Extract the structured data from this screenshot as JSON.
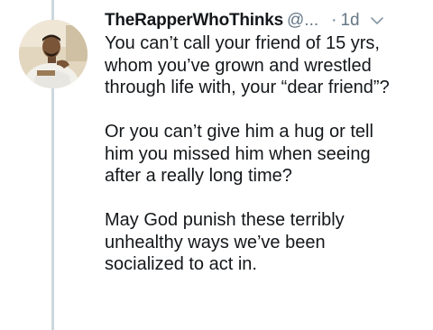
{
  "tweet": {
    "display_name": "TheRapperWhoThinks",
    "handle": "@...",
    "separator": "·",
    "time": "1d",
    "paragraphs": [
      "You can’t call your friend of 15 yrs,\nwhom you’ve grown and wrestled\nthrough life with, your “dear friend”?",
      "Or you can’t give him a hug or tell\nhim you missed him when seeing\nafter a really long time?",
      "May God punish these terribly\nunhealthy ways we’ve been\nsocialized to act in."
    ]
  },
  "icons": {
    "caret": "chevron-down-icon",
    "avatar": "profile-photo"
  },
  "colors": {
    "text": "#14171a",
    "secondary": "#657786",
    "thread_line": "#ccd6dd"
  }
}
